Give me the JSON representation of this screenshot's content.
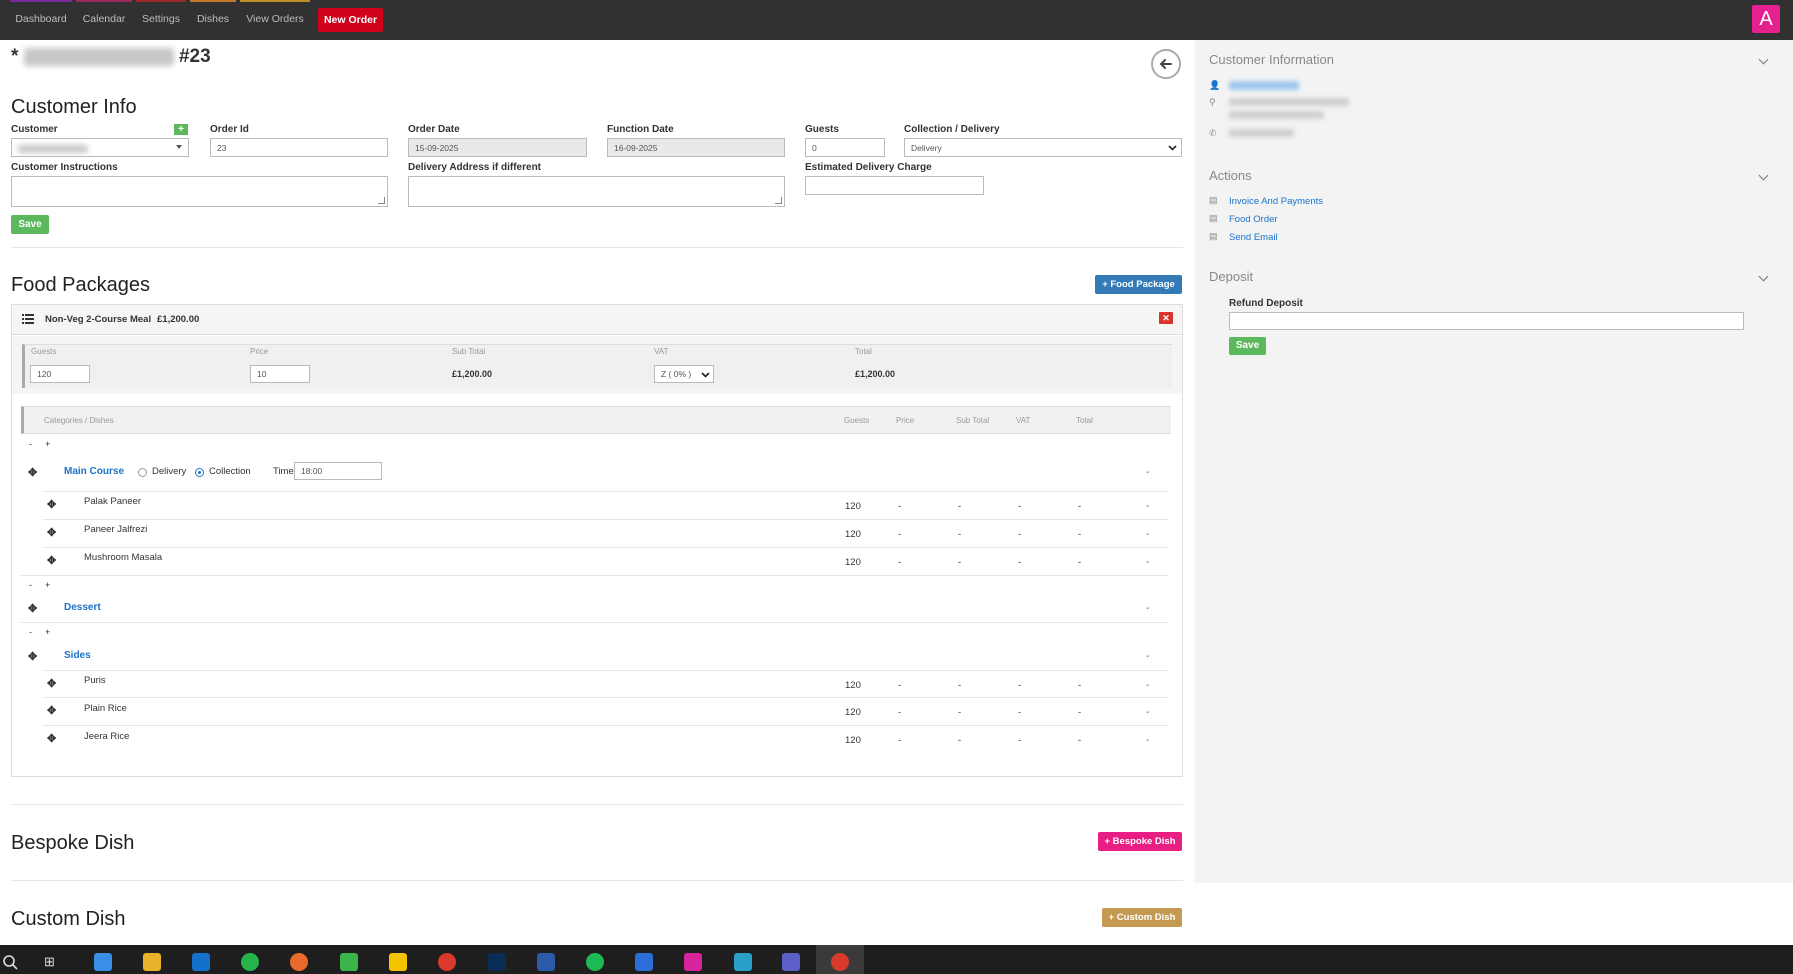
{
  "nav": {
    "items": [
      {
        "label": "Dashboard",
        "color": "#7a2a9a"
      },
      {
        "label": "Calendar",
        "color": "#9a2a5a"
      },
      {
        "label": "Settings",
        "color": "#9a2a2a"
      },
      {
        "label": "Dishes",
        "color": "#c07a2a"
      },
      {
        "label": "View Orders",
        "color": "#c0902a"
      }
    ],
    "new_order": "New Order",
    "app_badge": "A"
  },
  "page": {
    "asterisk": "*",
    "order_number": "#23"
  },
  "customer_info": {
    "title": "Customer Info",
    "customer_label": "Customer",
    "order_id_label": "Order Id",
    "order_id_value": "23",
    "order_date_label": "Order Date",
    "order_date_value": "15-09-2025",
    "function_date_label": "Function Date",
    "function_date_value": "16-09-2025",
    "guests_label": "Guests",
    "guests_value": "0",
    "collection_label": "Collection / Delivery",
    "collection_value": "Delivery",
    "instructions_label": "Customer Instructions",
    "delivery_address_label": "Delivery Address if different",
    "delivery_charge_label": "Estimated Delivery Charge",
    "save": "Save"
  },
  "food_packages": {
    "title": "Food Packages",
    "add_button": "Food Package",
    "package_name": "Non-Veg 2-Course Meal",
    "package_price": "£1,200.00",
    "grid_headers": {
      "guests": "Guests",
      "price": "Price",
      "sub_total": "Sub Total",
      "vat": "VAT",
      "total": "Total"
    },
    "guests_value": "120",
    "price_value": "10",
    "sub_total_value": "£1,200.00",
    "vat_value": "Z ( 0% )",
    "total_value": "£1,200.00",
    "cat_headers": {
      "categories": "Categories / Dishes",
      "guests": "Guests",
      "price": "Price",
      "sub_total": "Sub Total",
      "vat": "VAT",
      "total": "Total"
    },
    "delivery_radio": "Delivery",
    "collection_radio": "Collection",
    "time_label": "Time",
    "time_value": "18:00",
    "categories": [
      {
        "name": "Main Course",
        "dishes": [
          {
            "name": "Palak Paneer",
            "guests": "120"
          },
          {
            "name": "Paneer Jalfrezi",
            "guests": "120"
          },
          {
            "name": "Mushroom Masala",
            "guests": "120"
          }
        ]
      },
      {
        "name": "Dessert",
        "dishes": []
      },
      {
        "name": "Sides",
        "dishes": [
          {
            "name": "Puris",
            "guests": "120"
          },
          {
            "name": "Plain Rice",
            "guests": "120"
          },
          {
            "name": "Jeera Rice",
            "guests": "120"
          }
        ]
      }
    ],
    "dash": "-",
    "minus": "-",
    "plus": "+"
  },
  "bespoke": {
    "title": "Bespoke Dish",
    "add_button": "Bespoke Dish"
  },
  "custom": {
    "title": "Custom Dish",
    "add_button": "Custom Dish"
  },
  "sidebar": {
    "customer_information": "Customer Information",
    "actions": "Actions",
    "action_links": [
      "Invoice And Payments",
      "Food Order",
      "Send Email"
    ],
    "deposit": "Deposit",
    "refund_deposit_label": "Refund Deposit",
    "save": "Save"
  },
  "colors": {
    "nav_bg": "#313131",
    "new_order": "#d0021b",
    "app_badge": "#e5208f",
    "food_package_btn": "#337ab7",
    "bespoke_btn": "#e91e82",
    "custom_btn": "#c49a52",
    "link_blue": "#1a73c9",
    "save_green": "#5cb85c"
  }
}
